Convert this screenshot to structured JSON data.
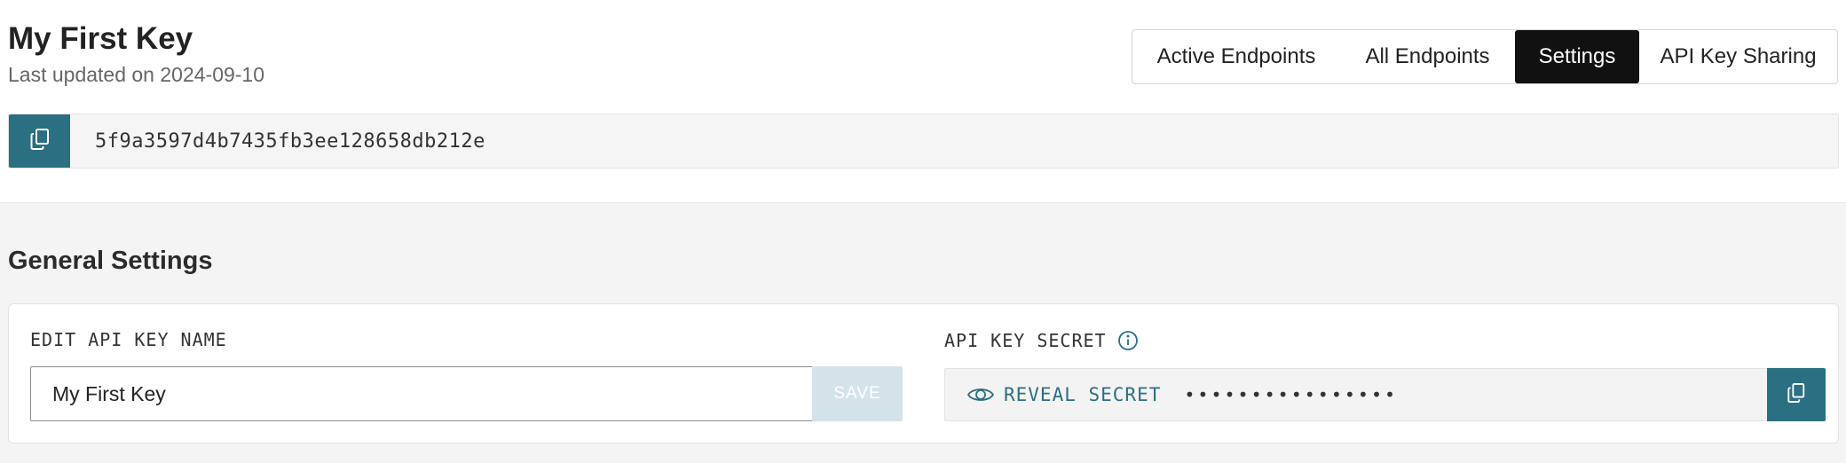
{
  "header": {
    "title": "My First Key",
    "subtitle": "Last updated on 2024-09-10"
  },
  "tabs": [
    {
      "label": "Active Endpoints",
      "active": false
    },
    {
      "label": "All Endpoints",
      "active": false
    },
    {
      "label": "Settings",
      "active": true
    },
    {
      "label": "API Key Sharing",
      "active": false
    }
  ],
  "key": {
    "value": "5f9a3597d4b7435fb3ee128658db212e",
    "copy_icon": "copy-icon"
  },
  "settings": {
    "section_title": "General Settings",
    "name_label": "EDIT API KEY NAME",
    "name_value": "My First Key",
    "save_label": "SAVE",
    "secret_label": "API KEY SECRET",
    "reveal_label": "REVEAL SECRET",
    "masked_secret": "••••••••••••••••",
    "icons": {
      "info": "info-icon",
      "eye": "eye-icon",
      "copy": "copy-icon"
    }
  },
  "colors": {
    "accent": "#2b6f82",
    "active_tab": "#111111",
    "save_disabled": "#d3e3e9",
    "section_bg": "#f4f4f4"
  }
}
